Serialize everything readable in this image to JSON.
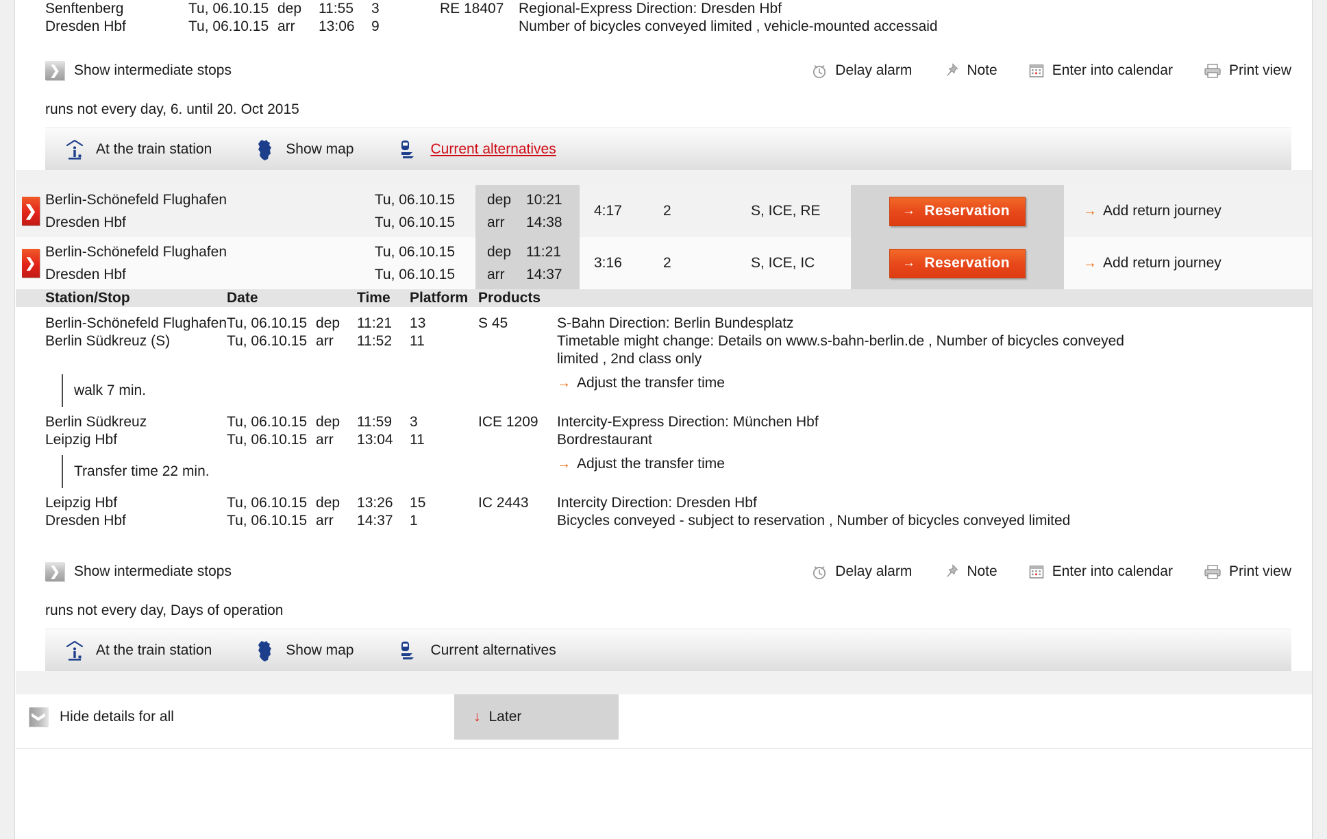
{
  "top_journey": {
    "tail_rows": [
      {
        "station": "Senftenberg",
        "date": "Tu, 06.10.15",
        "deparr": "dep",
        "time": "11:55",
        "platform": "3",
        "product": "RE 18407",
        "remark": "Regional-Express Direction: Dresden Hbf"
      },
      {
        "station": "Dresden Hbf",
        "date": "Tu, 06.10.15",
        "deparr": "arr",
        "time": "13:06",
        "platform": "9",
        "product": "",
        "remark": "Number of bicycles conveyed limited , vehicle-mounted accessaid"
      }
    ],
    "show_stops_label": "Show intermediate stops",
    "tools": [
      {
        "icon": "alarm-clock-icon",
        "label": "Delay alarm"
      },
      {
        "icon": "pin-icon",
        "label": "Note"
      },
      {
        "icon": "calendar-icon",
        "label": "Enter into calendar"
      },
      {
        "icon": "printer-icon",
        "label": "Print view"
      }
    ],
    "runs_note": "runs not every day, 6. until 20. Oct 2015",
    "station_bar": [
      {
        "icon": "info-station-icon",
        "label": "At the train station",
        "style": "normal"
      },
      {
        "icon": "map-germany-icon",
        "label": "Show map",
        "style": "normal"
      },
      {
        "icon": "train-alternatives-icon",
        "label": "Current alternatives",
        "style": "link-red"
      }
    ]
  },
  "summary_rows": [
    {
      "toggle_icon": "chevron-right-icon",
      "expanded": false,
      "origin": "Berlin-Schönefeld Flughafen",
      "destination": "Dresden Hbf",
      "dep_date": "Tu, 06.10.15",
      "arr_date": "Tu, 06.10.15",
      "dep_label": "dep",
      "arr_label": "arr",
      "dep_time": "10:21",
      "arr_time": "14:38",
      "duration": "4:17",
      "changes": "2",
      "products": "S, ICE, RE",
      "reservation_label": "Reservation",
      "return_label": "Add return journey"
    },
    {
      "toggle_icon": "chevron-down-icon",
      "expanded": true,
      "origin": "Berlin-Schönefeld Flughafen",
      "destination": "Dresden Hbf",
      "dep_date": "Tu, 06.10.15",
      "arr_date": "Tu, 06.10.15",
      "dep_label": "dep",
      "arr_label": "arr",
      "dep_time": "11:21",
      "arr_time": "14:37",
      "duration": "3:16",
      "changes": "2",
      "products": "S, ICE, IC",
      "reservation_label": "Reservation",
      "return_label": "Add return journey"
    }
  ],
  "detail": {
    "headers": {
      "station": "Station/Stop",
      "date": "Date",
      "time": "Time",
      "platform": "Platform",
      "products": "Products"
    },
    "legs": [
      {
        "dep": {
          "station": "Berlin-Schönefeld Flughafen",
          "date": "Tu, 06.10.15",
          "deparr": "dep",
          "time": "11:21",
          "platform": "13"
        },
        "arr": {
          "station": "Berlin Südkreuz (S)",
          "date": "Tu, 06.10.15",
          "deparr": "arr",
          "time": "11:52",
          "platform": "11"
        },
        "product": "S 45",
        "remark_line1": "S-Bahn Direction: Berlin Bundesplatz",
        "remark_line2": "Timetable might change: Details on www.s-bahn-berlin.de , Number of bicycles conveyed",
        "remark_line3": "limited , 2nd class only"
      },
      {
        "dep": {
          "station": "Berlin Südkreuz",
          "date": "Tu, 06.10.15",
          "deparr": "dep",
          "time": "11:59",
          "platform": "3"
        },
        "arr": {
          "station": "Leipzig Hbf",
          "date": "Tu, 06.10.15",
          "deparr": "arr",
          "time": "13:04",
          "platform": "11"
        },
        "product": "ICE 1209",
        "remark_line1": "Intercity-Express Direction: München Hbf",
        "remark_line2": "Bordrestaurant",
        "remark_line3": ""
      },
      {
        "dep": {
          "station": "Leipzig Hbf",
          "date": "Tu, 06.10.15",
          "deparr": "dep",
          "time": "13:26",
          "platform": "15"
        },
        "arr": {
          "station": "Dresden Hbf",
          "date": "Tu, 06.10.15",
          "deparr": "arr",
          "time": "14:37",
          "platform": "1"
        },
        "product": "IC 2443",
        "remark_line1": "Intercity Direction: Dresden Hbf",
        "remark_line2": "Bicycles conveyed - subject to reservation , Number of bicycles conveyed limited",
        "remark_line3": ""
      }
    ],
    "transfers": [
      {
        "text": "walk  7 min.",
        "adjust_label": "Adjust the transfer time"
      },
      {
        "text": "Transfer time 22 min.",
        "adjust_label": "Adjust the transfer time"
      }
    ],
    "show_stops_label": "Show intermediate stops",
    "tools": [
      {
        "icon": "alarm-clock-icon",
        "label": "Delay alarm"
      },
      {
        "icon": "pin-icon",
        "label": "Note"
      },
      {
        "icon": "calendar-icon",
        "label": "Enter into calendar"
      },
      {
        "icon": "printer-icon",
        "label": "Print view"
      }
    ],
    "runs_note": "runs not every day, Days of operation",
    "station_bar": [
      {
        "icon": "info-station-icon",
        "label": "At the train station",
        "style": "normal"
      },
      {
        "icon": "map-germany-icon",
        "label": "Show map",
        "style": "normal"
      },
      {
        "icon": "train-alternatives-icon",
        "label": "Current alternatives",
        "style": "normal"
      }
    ]
  },
  "bottom": {
    "hide_details_label": "Hide details for all",
    "later_label": "Later"
  },
  "colors": {
    "accent_red": "#e2231a",
    "accent_orange": "#ec6608",
    "link_red": "#d00c17",
    "panel_grey": "#f1f1f1",
    "header_grey": "#e4e4e4",
    "time_grey": "#d4d4d4"
  }
}
